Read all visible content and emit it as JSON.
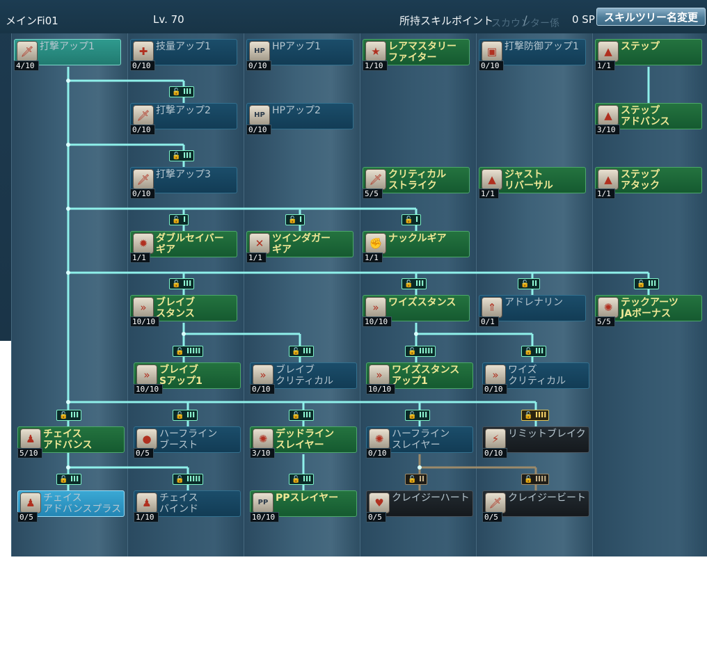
{
  "header": {
    "tree_name": "メインFi01",
    "level": "Lv. 70",
    "skill_points_label": "所持スキルポイント",
    "skill_points_value": "0 SP",
    "ghost_text": "スカウンター係",
    "rename_button": "スキルツリー名変更"
  },
  "skills": [
    {
      "id": "n1",
      "name": [
        "打撃アップ1"
      ],
      "level": "4/10",
      "style": "teal",
      "icon": "sword-icon"
    },
    {
      "id": "n2",
      "name": [
        "技量アップ1"
      ],
      "level": "0/10",
      "style": "blue",
      "icon": "dex-icon"
    },
    {
      "id": "n3",
      "name": [
        "HPアップ1"
      ],
      "level": "0/10",
      "style": "blue",
      "icon": "hp-icon"
    },
    {
      "id": "n4",
      "name": [
        "レアマスタリー",
        "ファイター"
      ],
      "level": "1/10",
      "style": "green",
      "icon": "star-sword-icon"
    },
    {
      "id": "n5",
      "name": [
        "打撃防御アップ1"
      ],
      "level": "0/10",
      "style": "blue",
      "icon": "shield-icon"
    },
    {
      "id": "n6",
      "name": [
        "ステップ"
      ],
      "level": "1/1",
      "style": "green",
      "icon": "boot-icon"
    },
    {
      "id": "n7",
      "name": [
        "打撃アップ2"
      ],
      "level": "0/10",
      "style": "blue",
      "icon": "sword-icon"
    },
    {
      "id": "n8",
      "name": [
        "HPアップ2"
      ],
      "level": "0/10",
      "style": "blue",
      "icon": "hp-icon"
    },
    {
      "id": "n9",
      "name": [
        "ステップ",
        "アドバンス"
      ],
      "level": "3/10",
      "style": "green",
      "icon": "boot-icon"
    },
    {
      "id": "n10",
      "name": [
        "打撃アップ3"
      ],
      "level": "0/10",
      "style": "blue",
      "icon": "sword-icon"
    },
    {
      "id": "n11",
      "name": [
        "クリティカル",
        "ストライク"
      ],
      "level": "5/5",
      "style": "green",
      "icon": "sword-icon"
    },
    {
      "id": "n12",
      "name": [
        "ジャスト",
        "リバーサル"
      ],
      "level": "1/1",
      "style": "green",
      "icon": "boot-icon"
    },
    {
      "id": "n13",
      "name": [
        "ステップ",
        "アタック"
      ],
      "level": "1/1",
      "style": "green",
      "icon": "boot-icon"
    },
    {
      "id": "n14",
      "name": [
        "ダブルセイバー",
        "ギア"
      ],
      "level": "1/1",
      "style": "green",
      "icon": "gear-icon"
    },
    {
      "id": "n15",
      "name": [
        "ツインダガー",
        "ギア"
      ],
      "level": "1/1",
      "style": "green",
      "icon": "dagger-icon"
    },
    {
      "id": "n16",
      "name": [
        "ナックルギア"
      ],
      "level": "1/1",
      "style": "green",
      "icon": "knuckle-icon"
    },
    {
      "id": "n17",
      "name": [
        "ブレイブ",
        "スタンス"
      ],
      "level": "10/10",
      "style": "green",
      "icon": "stance-icon"
    },
    {
      "id": "n18",
      "name": [
        "ワイズスタンス"
      ],
      "level": "10/10",
      "style": "green",
      "icon": "stance-icon"
    },
    {
      "id": "n19",
      "name": [
        "アドレナリン"
      ],
      "level": "0/1",
      "style": "blue",
      "icon": "arrow-up-icon"
    },
    {
      "id": "n20",
      "name": [
        "テックアーツ",
        "JAボーナス"
      ],
      "level": "5/5",
      "style": "green",
      "icon": "swirl-icon"
    },
    {
      "id": "n21",
      "name": [
        "ブレイブ",
        "Sアップ1"
      ],
      "level": "10/10",
      "style": "green",
      "icon": "stance-icon"
    },
    {
      "id": "n22",
      "name": [
        "ブレイブ",
        "クリティカル"
      ],
      "level": "0/10",
      "style": "blue",
      "icon": "stance-icon"
    },
    {
      "id": "n23",
      "name": [
        "ワイズスタンス",
        "アップ1"
      ],
      "level": "10/10",
      "style": "green",
      "icon": "stance-icon"
    },
    {
      "id": "n24",
      "name": [
        "ワイズ",
        "クリティカル"
      ],
      "level": "0/10",
      "style": "blue",
      "icon": "stance-icon"
    },
    {
      "id": "n25",
      "name": [
        "チェイス",
        "アドバンス"
      ],
      "level": "5/10",
      "style": "green",
      "icon": "chase-icon"
    },
    {
      "id": "n26",
      "name": [
        "ハーフライン",
        "ブースト"
      ],
      "level": "0/5",
      "style": "blue",
      "icon": "orb-icon"
    },
    {
      "id": "n27",
      "name": [
        "デッドライン",
        "スレイヤー"
      ],
      "level": "3/10",
      "style": "green",
      "icon": "swirl-icon"
    },
    {
      "id": "n28",
      "name": [
        "ハーフライン",
        "スレイヤー"
      ],
      "level": "0/10",
      "style": "blue",
      "icon": "swirl-icon"
    },
    {
      "id": "n29",
      "name": [
        "リミットブレイク"
      ],
      "level": "0/10",
      "style": "dark",
      "icon": "limit-icon"
    },
    {
      "id": "n30",
      "name": [
        "チェイス",
        "アドバンスプラス"
      ],
      "level": "0/5",
      "style": "cyan",
      "icon": "chase-icon"
    },
    {
      "id": "n31",
      "name": [
        "チェイス",
        "バインド"
      ],
      "level": "1/10",
      "style": "blue",
      "icon": "chase-icon"
    },
    {
      "id": "n32",
      "name": [
        "PPスレイヤー"
      ],
      "level": "10/10",
      "style": "green",
      "icon": "pp-icon"
    },
    {
      "id": "n33",
      "name": [
        "クレイジーハート"
      ],
      "level": "0/5",
      "style": "dark",
      "icon": "heart-icon"
    },
    {
      "id": "n34",
      "name": [
        "クレイジービート"
      ],
      "level": "0/5",
      "style": "dark",
      "icon": "sword-icon"
    }
  ],
  "locks": [
    {
      "id": "l1",
      "tier": "III",
      "state": "open"
    },
    {
      "id": "l2",
      "tier": "III",
      "state": "open"
    },
    {
      "id": "l3",
      "tier": "I",
      "state": "open"
    },
    {
      "id": "l4",
      "tier": "I",
      "state": "open"
    },
    {
      "id": "l5",
      "tier": "I",
      "state": "open"
    },
    {
      "id": "l6",
      "tier": "III",
      "state": "open"
    },
    {
      "id": "l7",
      "tier": "III",
      "state": "open"
    },
    {
      "id": "l8",
      "tier": "II",
      "state": "open"
    },
    {
      "id": "l9",
      "tier": "III",
      "state": "open"
    },
    {
      "id": "l10",
      "tier": "IIIII",
      "state": "open"
    },
    {
      "id": "l11",
      "tier": "III",
      "state": "open"
    },
    {
      "id": "l12",
      "tier": "IIIII",
      "state": "open"
    },
    {
      "id": "l13",
      "tier": "III",
      "state": "open"
    },
    {
      "id": "l14",
      "tier": "III",
      "state": "open"
    },
    {
      "id": "l15",
      "tier": "III",
      "state": "open"
    },
    {
      "id": "l16",
      "tier": "III",
      "state": "open"
    },
    {
      "id": "l17",
      "tier": "III",
      "state": "open"
    },
    {
      "id": "l18",
      "tier": "IIII",
      "state": "locked"
    },
    {
      "id": "l19",
      "tier": "III",
      "state": "open"
    },
    {
      "id": "l20",
      "tier": "IIIII",
      "state": "open"
    },
    {
      "id": "l21",
      "tier": "III",
      "state": "open"
    },
    {
      "id": "l22",
      "tier": "II",
      "state": "tan"
    },
    {
      "id": "l23",
      "tier": "IIII",
      "state": "tan"
    }
  ],
  "colors": {
    "line": "#8ff0ea",
    "line_inactive": "#9c8a6a",
    "node_green": "#1b6a38",
    "node_blue": "#164866",
    "level_text": "#f0e896"
  }
}
